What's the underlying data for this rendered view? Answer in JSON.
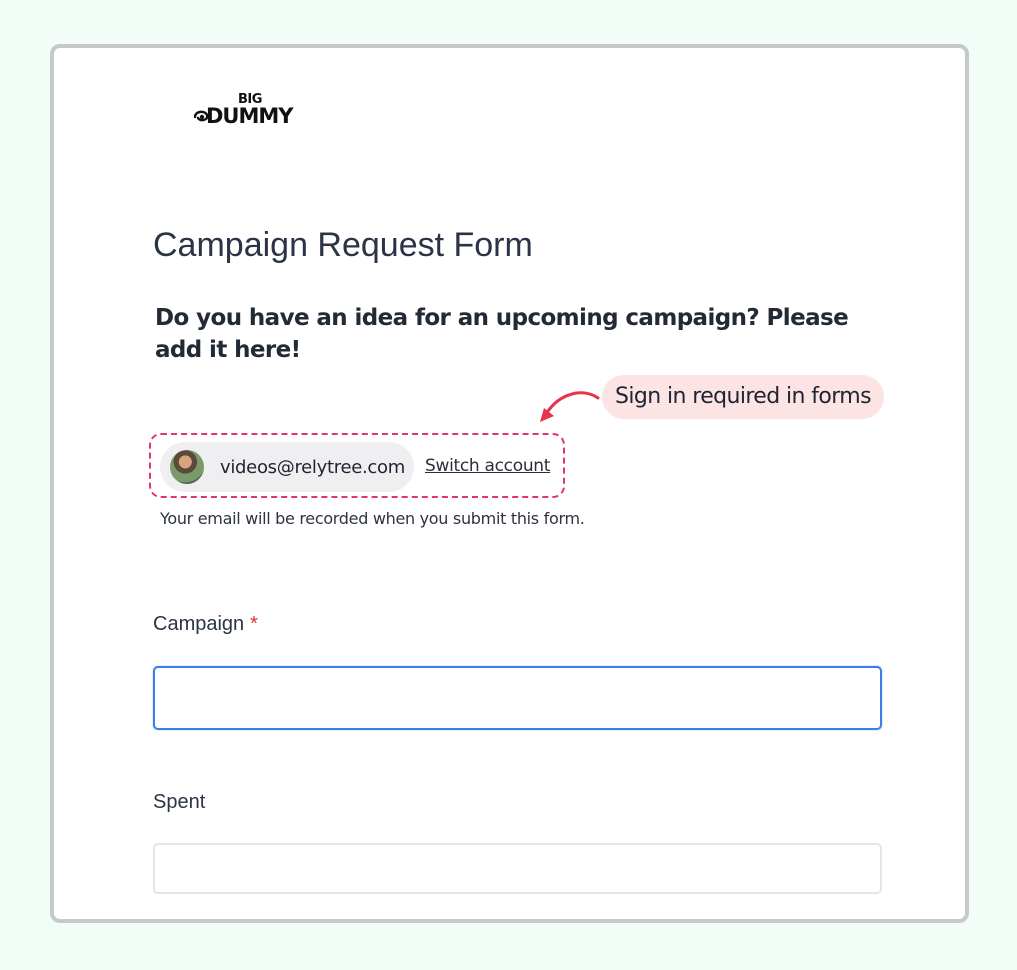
{
  "brand": {
    "logo_top": "BIG",
    "logo_main": "DUMMY"
  },
  "form": {
    "title": "Campaign Request Form",
    "description": "Do you have an idea for an upcoming campaign? Please add it here!"
  },
  "annotation": {
    "callout_text": "Sign in required in forms",
    "callout_bg": "#fde4e4",
    "highlight_color": "#e0356f"
  },
  "account": {
    "email": "videos@relytree.com",
    "switch_label": "Switch account",
    "recording_note": "Your email will be recorded when you submit this form."
  },
  "fields": [
    {
      "label": "Campaign",
      "required": true,
      "required_mark": "*",
      "value": "",
      "focused": true
    },
    {
      "label": "Spent",
      "required": false,
      "value": "",
      "focused": false
    }
  ],
  "colors": {
    "page_bg": "#f2fdf8",
    "focus_border": "#3b7ee6",
    "required_mark": "#e0302b"
  }
}
